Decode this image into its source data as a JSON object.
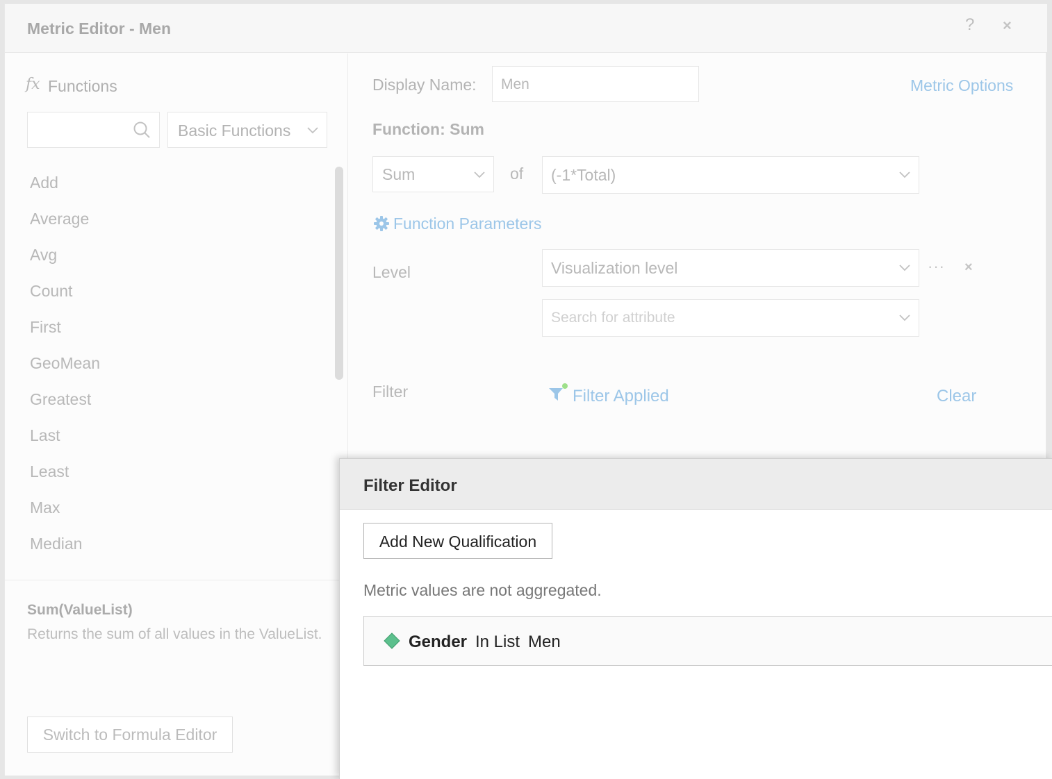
{
  "metric_editor": {
    "title": "Metric Editor - Men",
    "help_label": "?",
    "close_label": "×",
    "functions_panel": {
      "heading": "Functions",
      "fx_symbol": "fx",
      "search_placeholder": "",
      "category": "Basic Functions",
      "items": [
        "Add",
        "Average",
        "Avg",
        "Count",
        "First",
        "GeoMean",
        "Greatest",
        "Last",
        "Least",
        "Max",
        "Median"
      ],
      "signature": "Sum(ValueList)",
      "description": "Returns the sum of all values in the ValueList.",
      "formula_button": "Switch to Formula Editor"
    },
    "definition": {
      "display_name_label": "Display Name:",
      "display_name_value": "Men",
      "metric_options": "Metric Options",
      "function_heading": "Function: Sum",
      "aggregation": "Sum",
      "of_label": "of",
      "argument": "(-1*Total)",
      "params_link": "Function Parameters",
      "level_label": "Level",
      "level_value": "Visualization level",
      "more_label": "···",
      "remove_label": "×",
      "attribute_placeholder": "Search for attribute",
      "filter_label": "Filter",
      "filter_applied": "Filter Applied",
      "clear": "Clear"
    }
  },
  "filter_editor": {
    "title": "Filter Editor",
    "add_button": "Add New Qualification",
    "note": "Metric values are not aggregated.",
    "qualification": {
      "attribute": "Gender",
      "operator": "In List",
      "value": "Men"
    }
  },
  "colors": {
    "link_blue": "#9cc6e8",
    "attribute_green": "#5cc08d",
    "indicator_green": "#9ee08a"
  }
}
